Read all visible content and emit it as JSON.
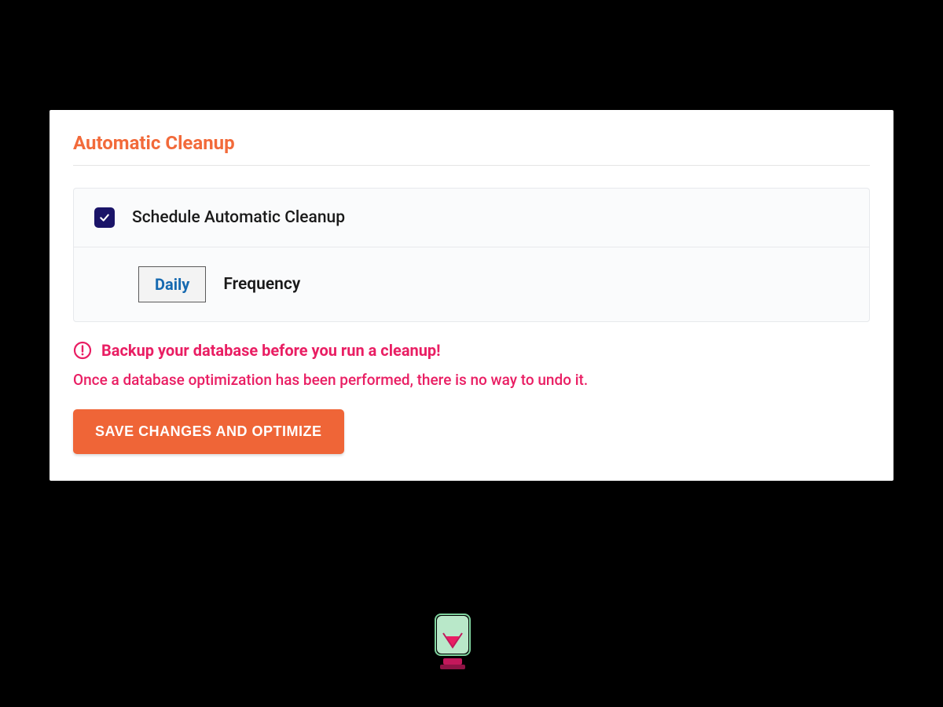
{
  "section": {
    "title": "Automatic Cleanup",
    "schedule_checkbox_checked": true,
    "schedule_label": "Schedule Automatic Cleanup",
    "frequency_value": "Daily",
    "frequency_label": "Frequency"
  },
  "warning": {
    "headline": "Backup your database before you run a cleanup!",
    "subtext": "Once a database optimization has been performed, there is no way to undo it."
  },
  "actions": {
    "save_button": "SAVE CHANGES AND OPTIMIZE"
  },
  "colors": {
    "accent_orange": "#f26a3a",
    "button_orange": "#ef6537",
    "warning_pink": "#e91e63",
    "checkbox_navy": "#1a1468",
    "select_blue": "#1669b0"
  }
}
